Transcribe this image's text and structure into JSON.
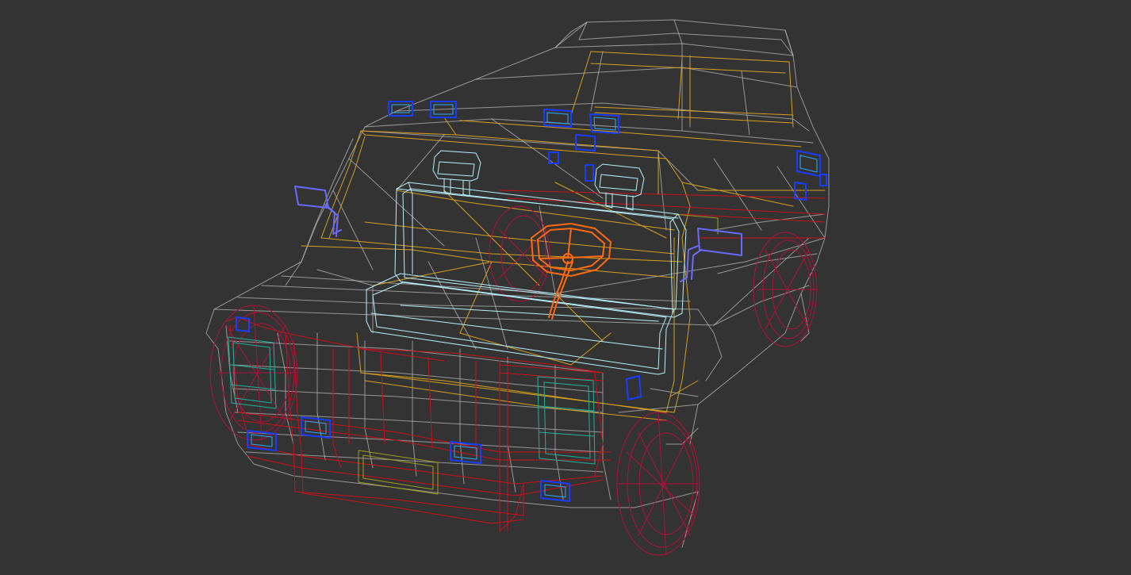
{
  "viewport": {
    "background_color": "#333333",
    "render_mode": "wireframe"
  },
  "model": {
    "wire_colors": {
      "body_shell": "#b8b8b8",
      "cabin_frame": "#d4a020",
      "bumper_wheels": "#c8101e",
      "wheel_tires": "#b0103e",
      "seats": "#b8f0f8",
      "steering_wheel": "#ff6a10",
      "lights": "#1a3cff",
      "light_inner": "#2aa8ff",
      "mirrors": "#6a6aff",
      "grille_inserts": "#20b098",
      "license_plate": "#9aa020"
    },
    "parts": [
      {
        "name": "body-shell-wireframe",
        "icon": "vehicle-body"
      },
      {
        "name": "cabin-frame-wireframe",
        "icon": "cabin-frame"
      },
      {
        "name": "front-bumper-wireframe",
        "icon": "bumper"
      },
      {
        "name": "wheel-front-left",
        "icon": "wheel"
      },
      {
        "name": "wheel-front-right",
        "icon": "wheel"
      },
      {
        "name": "wheel-rear-right",
        "icon": "wheel"
      },
      {
        "name": "bench-seat",
        "icon": "seat"
      },
      {
        "name": "steering-wheel",
        "icon": "steering-wheel"
      },
      {
        "name": "side-mirrors",
        "icon": "mirror"
      },
      {
        "name": "light-fixtures",
        "icon": "light"
      },
      {
        "name": "license-plate",
        "icon": "plate"
      }
    ]
  }
}
